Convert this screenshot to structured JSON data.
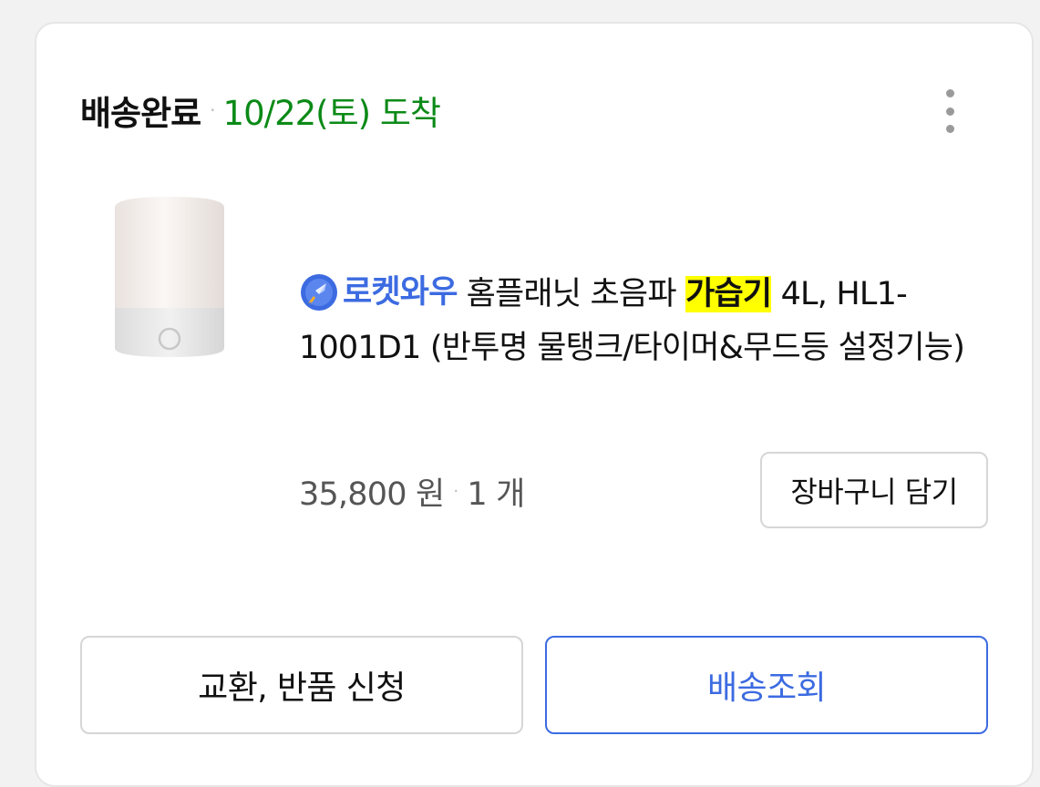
{
  "order": {
    "status": "배송완료",
    "separator": "·",
    "delivery_date": "10/22(토) 도착"
  },
  "product": {
    "badge_text": "로켓와우",
    "title_before": "홈플래닛 초음파 ",
    "title_highlight": "가습기",
    "title_after": " 4L, HL1-1001D1 (반투명 물탱크/타이머&무드등 설정기능)",
    "price": "35,800 원",
    "price_separator": "·",
    "quantity": "1 개",
    "image_icon": "humidifier-product-image"
  },
  "buttons": {
    "add_to_cart": "장바구니 담기",
    "exchange_return": "교환, 반품 신청",
    "track_delivery": "배송조회"
  },
  "icons": {
    "more": "more-vertical-icon",
    "rocket": "rocket-icon"
  },
  "colors": {
    "delivered_green": "#0b8a17",
    "rocket_blue": "#3c6be1",
    "highlight_yellow": "#ffff00"
  }
}
